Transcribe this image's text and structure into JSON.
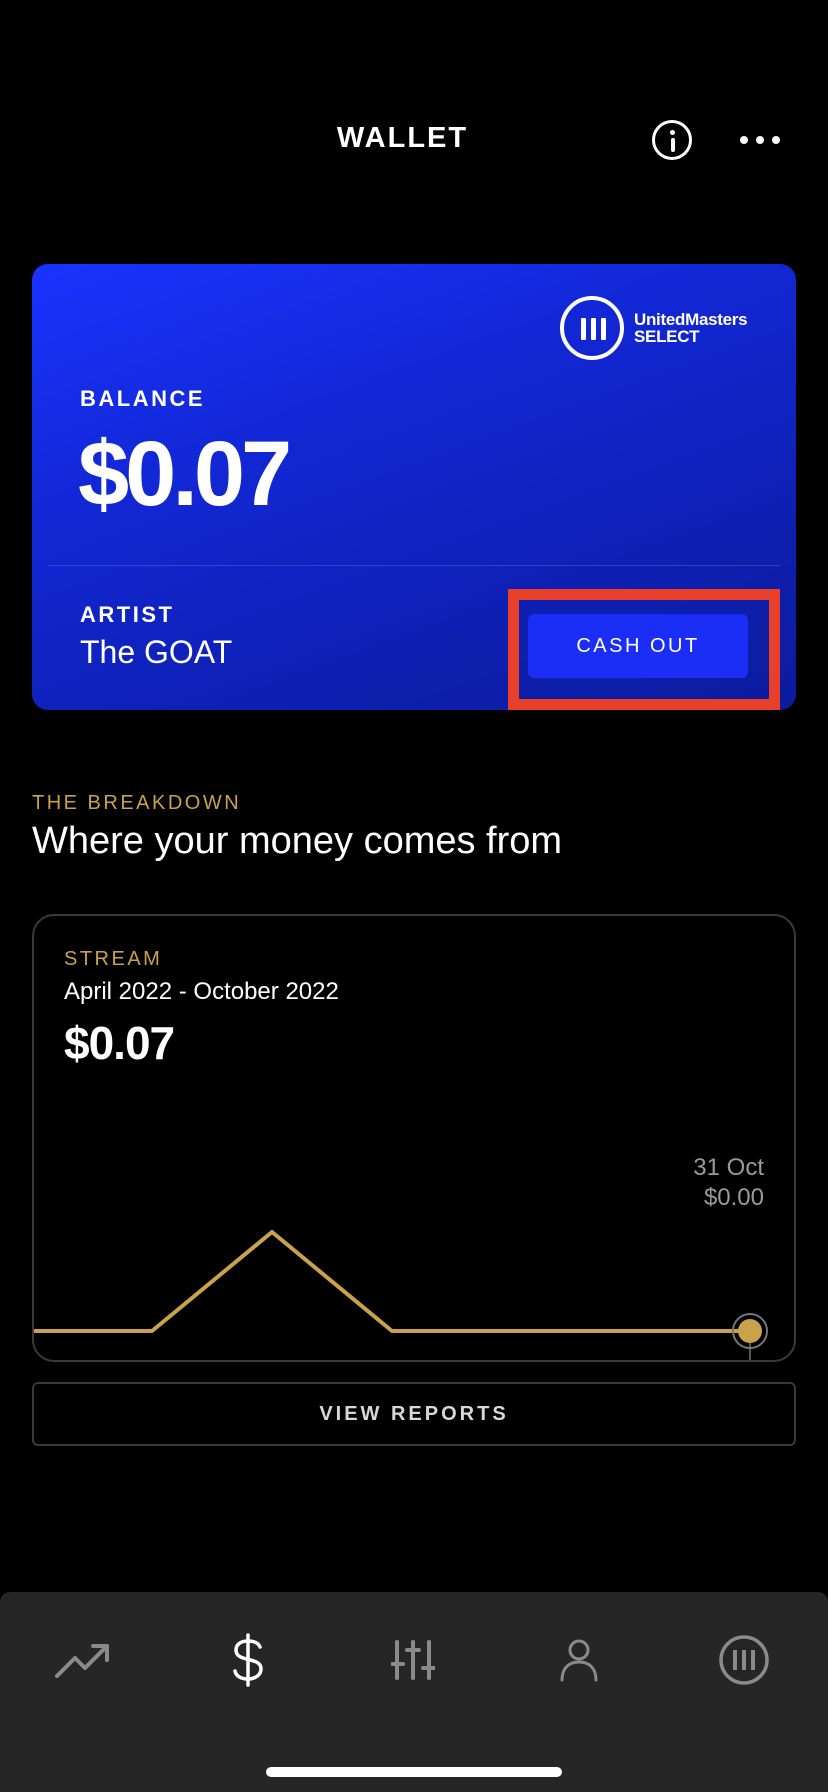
{
  "header": {
    "title": "WALLET",
    "info_icon": "info-icon",
    "more_icon": "more-icon"
  },
  "balance_card": {
    "logo": {
      "icon": "unitedmasters-logo-icon",
      "line1": "UnitedMasters",
      "line2": "SELECT"
    },
    "balance_label": "BALANCE",
    "balance_value": "$0.07",
    "artist_label": "ARTIST",
    "artist_name": "The GOAT",
    "cash_out_label": "CASH OUT",
    "highlight_color": "#e8402a"
  },
  "breakdown": {
    "kicker": "THE BREAKDOWN",
    "title": "Where your money comes from"
  },
  "stream_card": {
    "kicker": "STREAM",
    "period": "April 2022 - October 2022",
    "total": "$0.07",
    "tooltip": {
      "date": "31 Oct",
      "value": "$0.00"
    },
    "line_color": "#c9a24b"
  },
  "view_reports_label": "VIEW REPORTS",
  "tabbar": {
    "items": [
      {
        "name": "tab-trends",
        "icon": "trending-up-icon",
        "active": false
      },
      {
        "name": "tab-wallet",
        "icon": "dollar-icon",
        "active": true
      },
      {
        "name": "tab-tools",
        "icon": "sliders-icon",
        "active": false
      },
      {
        "name": "tab-profile",
        "icon": "user-icon",
        "active": false
      },
      {
        "name": "tab-unitedmasters",
        "icon": "unitedmasters-logo-icon",
        "active": false
      }
    ]
  }
}
